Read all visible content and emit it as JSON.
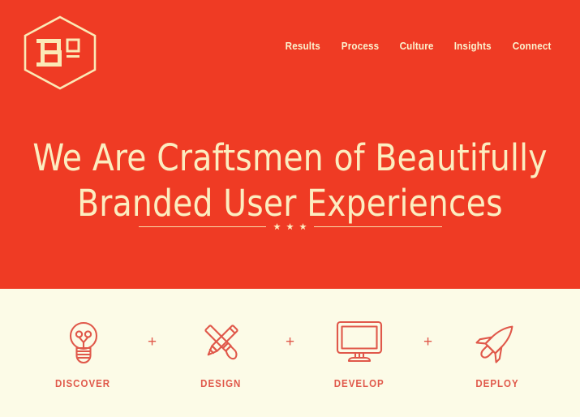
{
  "theme": {
    "brand_red": "#ef3b24",
    "cream": "#fcfbe7",
    "headline_cream": "#fcedc0",
    "icon_red": "#e0584a"
  },
  "header": {
    "logo": {
      "icon": "hexagon-ba-logo",
      "letter_main": "B",
      "letter_sup": "a"
    },
    "nav": [
      {
        "label": "Results"
      },
      {
        "label": "Process"
      },
      {
        "label": "Culture"
      },
      {
        "label": "Insights"
      },
      {
        "label": "Connect"
      }
    ]
  },
  "hero": {
    "headline_line1": "We Are Craftsmen of Beautifully",
    "headline_line2": "Branded User Experiences",
    "divider": {
      "star_count": 3,
      "star_icon": "star-icon"
    },
    "notch_icon": "triangle-down-icon"
  },
  "process": {
    "separator": "+",
    "steps": [
      {
        "label": "DISCOVER",
        "icon": "lightbulb-icon"
      },
      {
        "label": "DESIGN",
        "icon": "pencil-brush-cross-icon"
      },
      {
        "label": "DEVELOP",
        "icon": "monitor-icon"
      },
      {
        "label": "DEPLOY",
        "icon": "rocket-icon"
      }
    ]
  }
}
